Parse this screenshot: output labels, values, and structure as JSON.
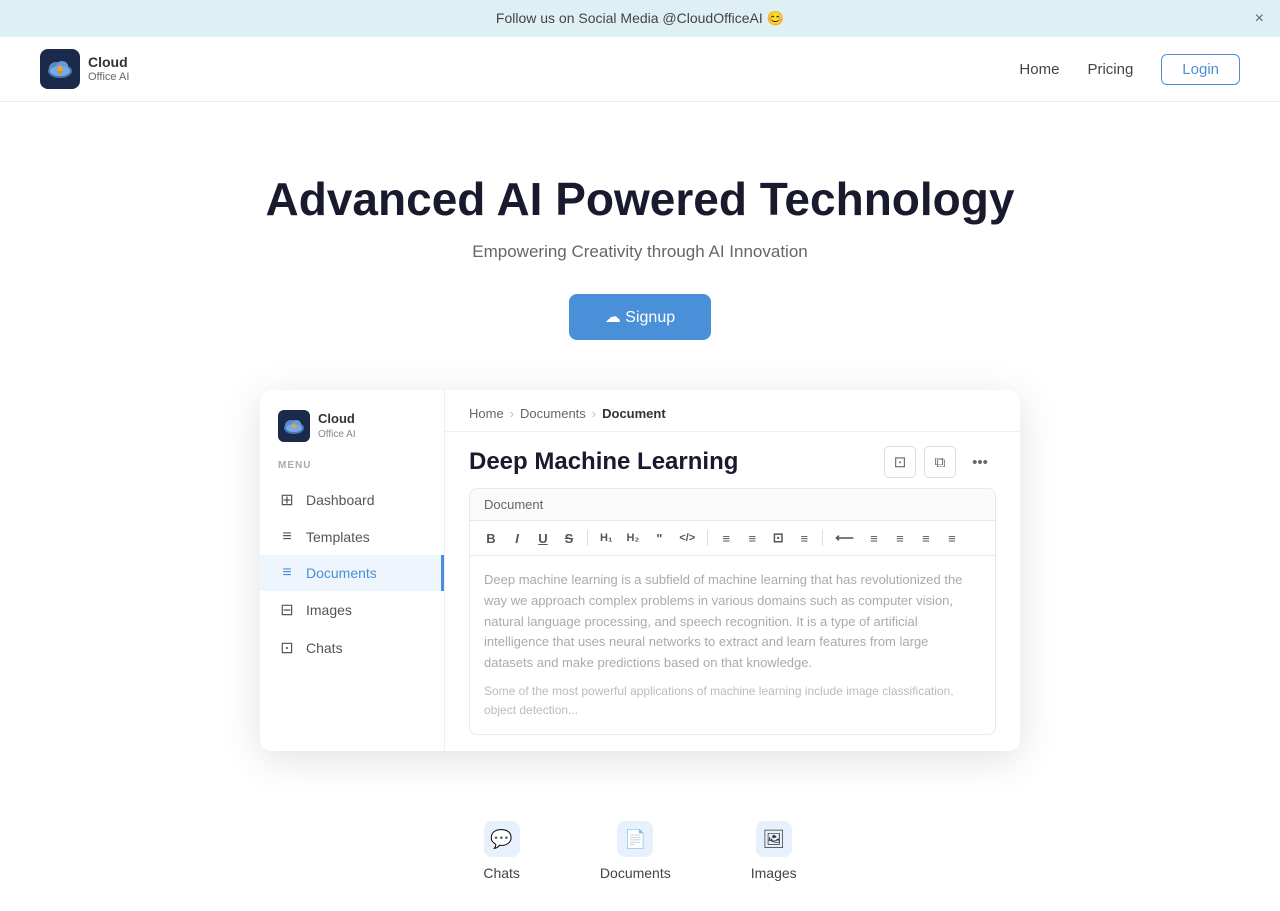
{
  "banner": {
    "text": "Follow us on Social Media @CloudOfficeAI 😊",
    "close_label": "×"
  },
  "navbar": {
    "logo": {
      "cloud_label": "Cloud",
      "sub_label": "Office AI"
    },
    "links": [
      {
        "label": "Home",
        "href": "#"
      },
      {
        "label": "Pricing",
        "href": "#"
      }
    ],
    "login_label": "Login"
  },
  "hero": {
    "title": "Advanced AI Powered Technology",
    "subtitle": "Empowering Creativity through AI Innovation",
    "cta_label": "☁ Signup"
  },
  "sidebar": {
    "logo": {
      "cloud_label": "Cloud",
      "sub_label": "Office AI"
    },
    "menu_label": "MENU",
    "items": [
      {
        "id": "dashboard",
        "label": "Dashboard",
        "icon": "⊞"
      },
      {
        "id": "templates",
        "label": "Templates",
        "icon": "≡"
      },
      {
        "id": "documents",
        "label": "Documents",
        "icon": "≡",
        "active": true
      },
      {
        "id": "images",
        "label": "Images",
        "icon": "⊟"
      },
      {
        "id": "chats",
        "label": "Chats",
        "icon": "⊡"
      }
    ]
  },
  "document": {
    "breadcrumb": {
      "home": "Home",
      "documents": "Documents",
      "current": "Document"
    },
    "title": "Deep Machine Learning",
    "tab_label": "Document",
    "toolbar": {
      "buttons": [
        "B",
        "I",
        "U",
        "S",
        "H₁",
        "H₂",
        "\"",
        "</>",
        "≡",
        "≡",
        "⊡",
        "≡",
        "⟵",
        "≡",
        "≡",
        "≡",
        "≡"
      ]
    },
    "content": {
      "para1": "Deep machine learning is a subfield of machine learning that has revolutionized the way we approach complex problems in various domains such as computer vision, natural language processing, and speech recognition. It is a type of artificial intelligence that uses neural networks to extract and learn features from large datasets and make predictions based on that knowledge.",
      "para2": "Some of the most powerful applications of machine learning include image classification, object detection..."
    }
  },
  "bottom_features": [
    {
      "id": "chats",
      "label": "Chats",
      "icon": "💬",
      "color": "#e8f0fb"
    },
    {
      "id": "documents",
      "label": "Documents",
      "icon": "📄",
      "color": "#e8f0fb"
    },
    {
      "id": "images",
      "label": "Images",
      "icon": "🖼",
      "color": "#e8f0fb"
    }
  ]
}
